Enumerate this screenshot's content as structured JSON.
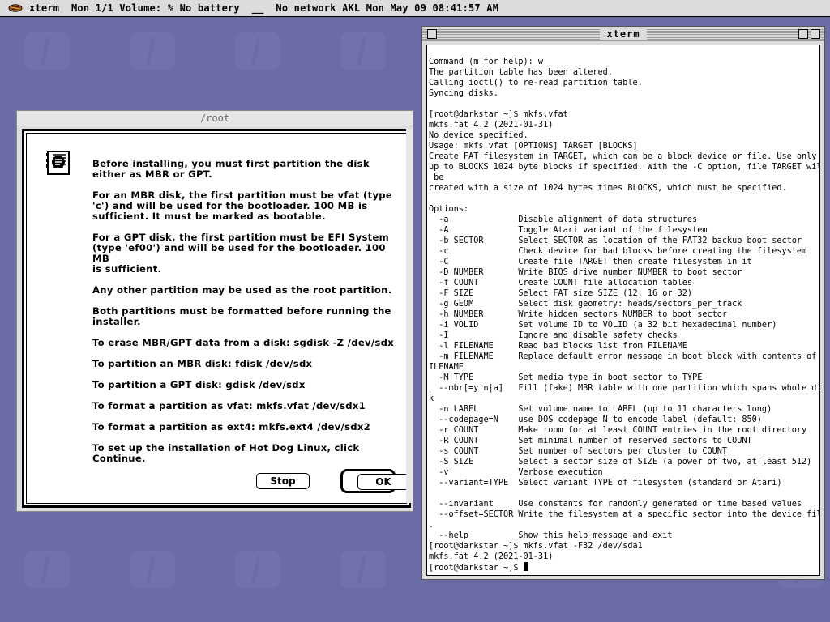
{
  "menubar": {
    "text": "xterm  Mon 1/1 Volume: % No battery  __  No network AKL Mon May 09 08:41:57 AM"
  },
  "dialog": {
    "title": "/root",
    "paragraphs": [
      "Before installing, you must first partition the disk\neither as MBR or GPT.",
      "For an MBR disk, the first partition must be vfat (type\n'c') and will be used for the bootloader. 100 MB is\nsufficient. It must be marked as bootable.",
      "For a GPT disk, the first partition must be EFI System\n(type 'ef00') and will be used for the bootloader. 100 MB\nis sufficient.",
      "Any other partition may be used as the root partition.",
      "Both partitions must be formatted before running the\ninstaller.",
      "To erase MBR/GPT data from a disk: sgdisk -Z /dev/sdx",
      "To partition an MBR disk: fdisk /dev/sdx",
      "To partition a GPT disk: gdisk /dev/sdx",
      "To format a partition as vfat: mkfs.vfat /dev/sdx1",
      "To format a partition as ext4: mkfs.ext4 /dev/sdx2",
      "To set up the installation of Hot Dog Linux, click\nContinue."
    ],
    "stop_label": "Stop",
    "ok_label": "OK"
  },
  "xterm": {
    "title": "xterm",
    "output": "Command (m for help): w\nThe partition table has been altered.\nCalling ioctl() to re-read partition table.\nSyncing disks.\n\n[root@darkstar ~]$ mkfs.vfat\nmkfs.fat 4.2 (2021-01-31)\nNo device specified.\nUsage: mkfs.vfat [OPTIONS] TARGET [BLOCKS]\nCreate FAT filesystem in TARGET, which can be a block device or file. Use only\nup to BLOCKS 1024 byte blocks if specified. With the -C option, file TARGET will\n be\ncreated with a size of 1024 bytes times BLOCKS, which must be specified.\n\nOptions:\n  -a              Disable alignment of data structures\n  -A              Toggle Atari variant of the filesystem\n  -b SECTOR       Select SECTOR as location of the FAT32 backup boot sector\n  -c              Check device for bad blocks before creating the filesystem\n  -C              Create file TARGET then create filesystem in it\n  -D NUMBER       Write BIOS drive number NUMBER to boot sector\n  -f COUNT        Create COUNT file allocation tables\n  -F SIZE         Select FAT size SIZE (12, 16 or 32)\n  -g GEOM         Select disk geometry: heads/sectors_per_track\n  -h NUMBER       Write hidden sectors NUMBER to boot sector\n  -i VOLID        Set volume ID to VOLID (a 32 bit hexadecimal number)\n  -I              Ignore and disable safety checks\n  -l FILENAME     Read bad blocks list from FILENAME\n  -m FILENAME     Replace default error message in boot block with contents of F\nILENAME\n  -M TYPE         Set media type in boot sector to TYPE\n  --mbr[=y|n|a]   Fill (fake) MBR table with one partition which spans whole dis\nk\n  -n LABEL        Set volume name to LABEL (up to 11 characters long)\n  --codepage=N    use DOS codepage N to encode label (default: 850)\n  -r COUNT        Make room for at least COUNT entries in the root directory\n  -R COUNT        Set minimal number of reserved sectors to COUNT\n  -s COUNT        Set number of sectors per cluster to COUNT\n  -S SIZE         Select a sector size of SIZE (a power of two, at least 512)\n  -v              Verbose execution\n  --variant=TYPE  Select variant TYPE of filesystem (standard or Atari)\n\n  --invariant     Use constants for randomly generated or time based values\n  --offset=SECTOR Write the filesystem at a specific sector into the device file\n.\n  --help          Show this help message and exit\n[root@darkstar ~]$ mkfs.vfat -F32 /dev/sda1\nmkfs.fat 4.2 (2021-01-31)\n[root@darkstar ~]$ "
  }
}
